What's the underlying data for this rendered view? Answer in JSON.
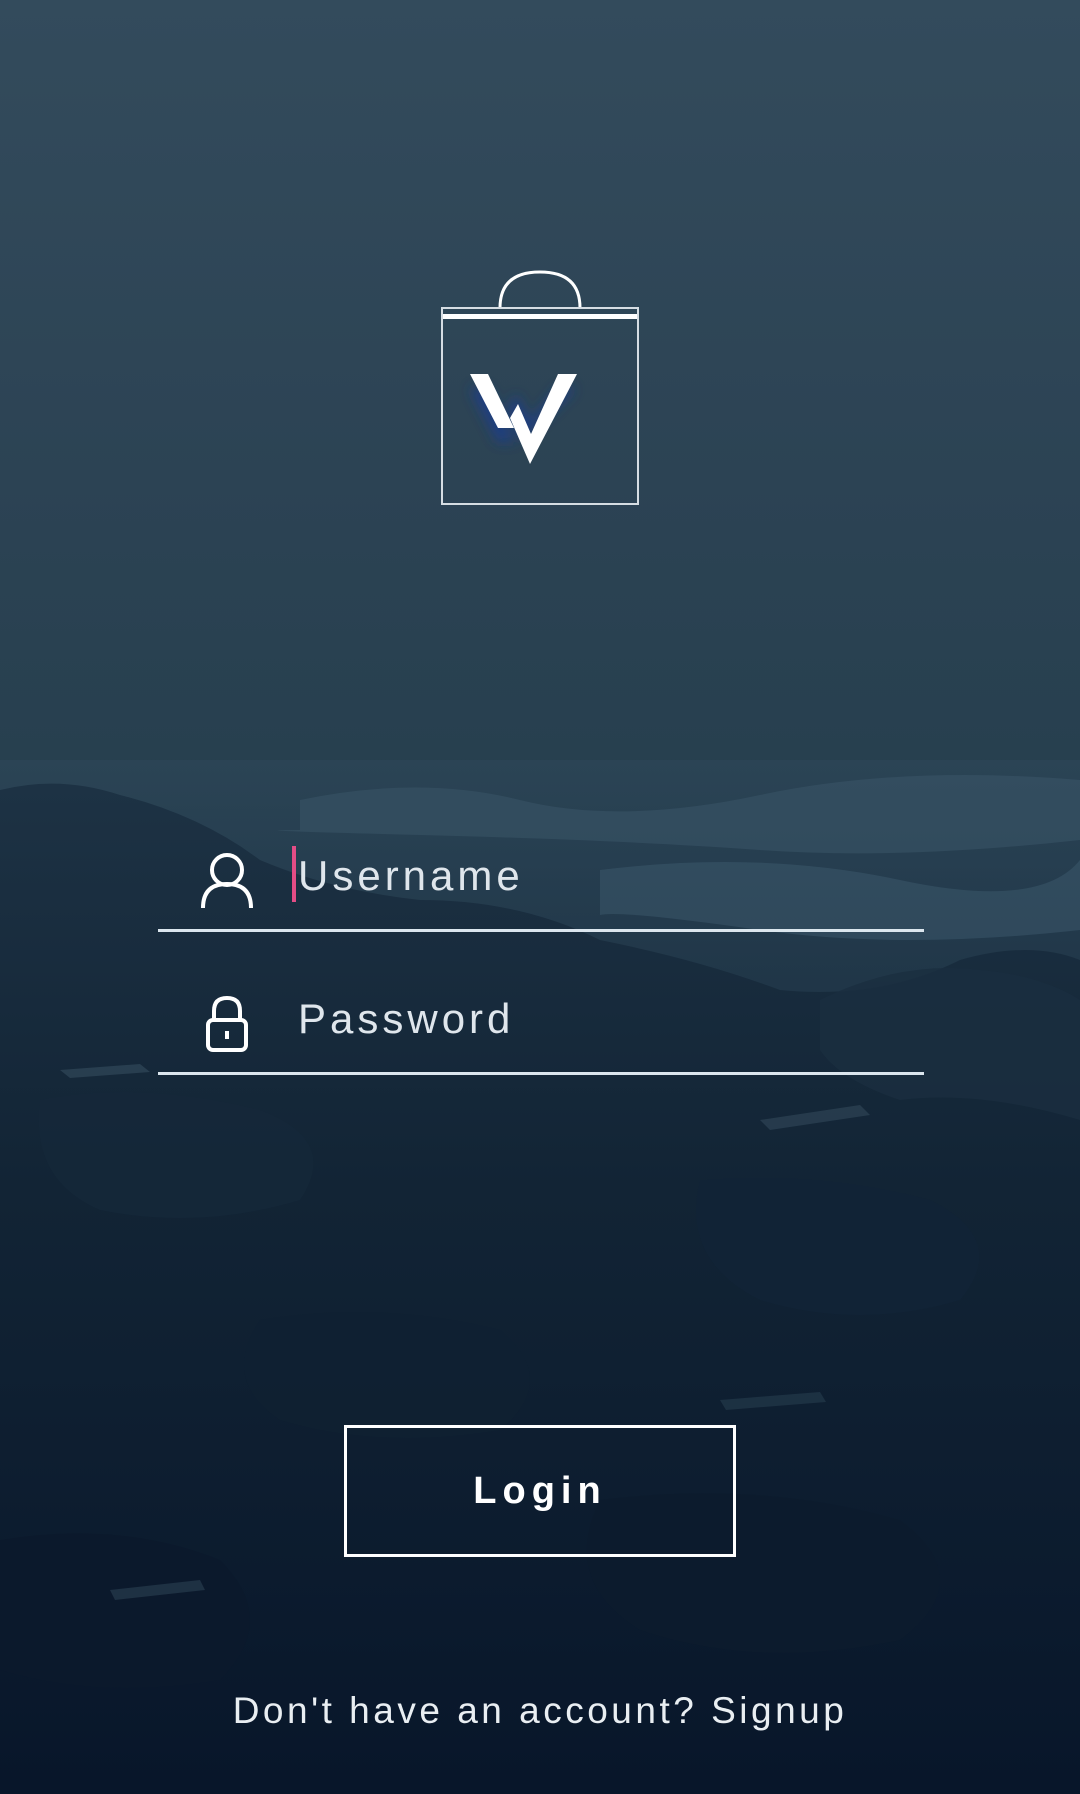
{
  "brand": {
    "logo_icon": "shopping-bag-w-logo-icon",
    "accent_color": "#e44d86"
  },
  "login_form": {
    "username": {
      "icon": "user-icon",
      "placeholder": "Username",
      "value": ""
    },
    "password": {
      "icon": "lock-icon",
      "placeholder": "Password",
      "value": ""
    },
    "login_label": "Login"
  },
  "signup": {
    "prompt": "Don't have an account?",
    "link_label": "Signup"
  }
}
